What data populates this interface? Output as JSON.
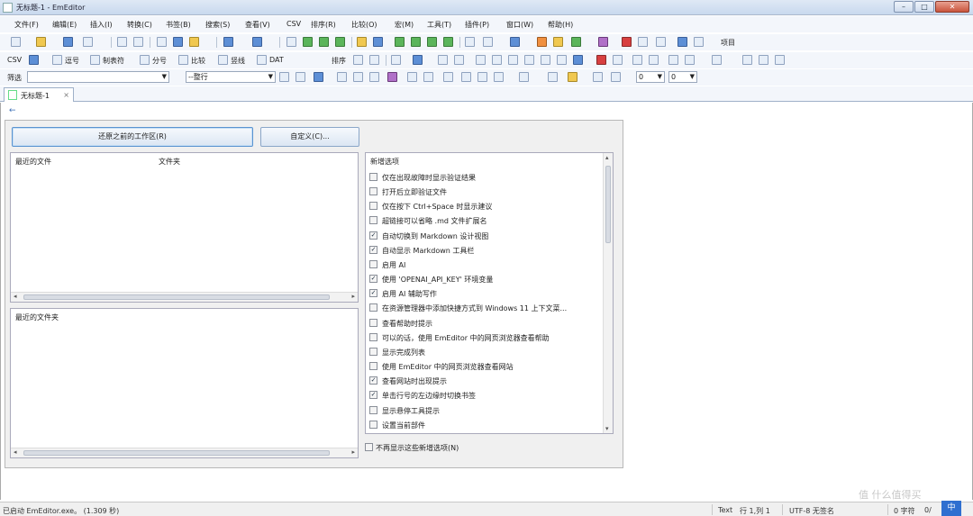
{
  "window": {
    "title": "无标题-1 - EmEditor"
  },
  "menu": [
    "文件(F)",
    "编辑(E)",
    "插入(I)",
    "转换(C)",
    "书签(B)",
    "搜索(S)",
    "查看(V)",
    "CSV",
    "排序(R)",
    "比较(O)",
    "宏(M)",
    "工具(T)",
    "插件(P)",
    "窗口(W)",
    "帮助(H)"
  ],
  "toolbar1": {
    "extra_label": "项目"
  },
  "toolbar2": {
    "csv_label": "CSV",
    "items": [
      "逗号",
      "制表符",
      "分号",
      "比较",
      "竖线",
      "DAT"
    ],
    "sort_label": "排序"
  },
  "toolbar3": {
    "filter_label": "筛选",
    "filter_value": "",
    "scope_value": "--整行",
    "num1": "0",
    "num2": "0"
  },
  "tab": {
    "label": "无标题-1",
    "close": "×"
  },
  "start": {
    "restore_button": "还原之前的工作区(R)",
    "customize_button": "自定义(C)...",
    "recent_files_header": "最近的文件",
    "folder_header": "文件夹",
    "recent_folders_header": "最近的文件夹",
    "new_options_header": "新增选项",
    "options": [
      {
        "label": "仅在出现故障时显示验证结果",
        "checked": false
      },
      {
        "label": "打开后立即验证文件",
        "checked": false
      },
      {
        "label": "仅在按下 Ctrl+Space 时显示建议",
        "checked": false
      },
      {
        "label": "超链接可以省略 .md 文件扩展名",
        "checked": false
      },
      {
        "label": "自动切换到 Markdown 设计视图",
        "checked": true
      },
      {
        "label": "自动显示 Markdown 工具栏",
        "checked": true
      },
      {
        "label": "启用 AI",
        "checked": false
      },
      {
        "label": "使用 'OPENAI_API_KEY' 环境变量",
        "checked": true
      },
      {
        "label": "启用 AI 辅助写作",
        "checked": true
      },
      {
        "label": "在资源管理器中添加快捷方式到 Windows 11 上下文菜...",
        "checked": false
      },
      {
        "label": "查看帮助时提示",
        "checked": false
      },
      {
        "label": "可以的话，使用 EmEditor 中的网页浏览器查看帮助",
        "checked": false
      },
      {
        "label": "显示完成列表",
        "checked": false
      },
      {
        "label": "使用 EmEditor 中的网页浏览器查看网站",
        "checked": false
      },
      {
        "label": "查看网站时出现提示",
        "checked": true
      },
      {
        "label": "单击行号的左边缘时切换书签",
        "checked": true
      },
      {
        "label": "显示悬停工具提示",
        "checked": false
      },
      {
        "label": "设置当前部件",
        "checked": false
      }
    ],
    "dont_show_label": "不再显示这些新增选项(N)"
  },
  "status": {
    "left": "已启动 EmEditor.exe。 (1.309 秒)",
    "mode": "Text",
    "position": "行 1,列 1",
    "encoding": "UTF-8 无签名",
    "chars": "0 字符",
    "extra": "0/"
  },
  "watermark": "值 什么值得买",
  "ime": "中"
}
